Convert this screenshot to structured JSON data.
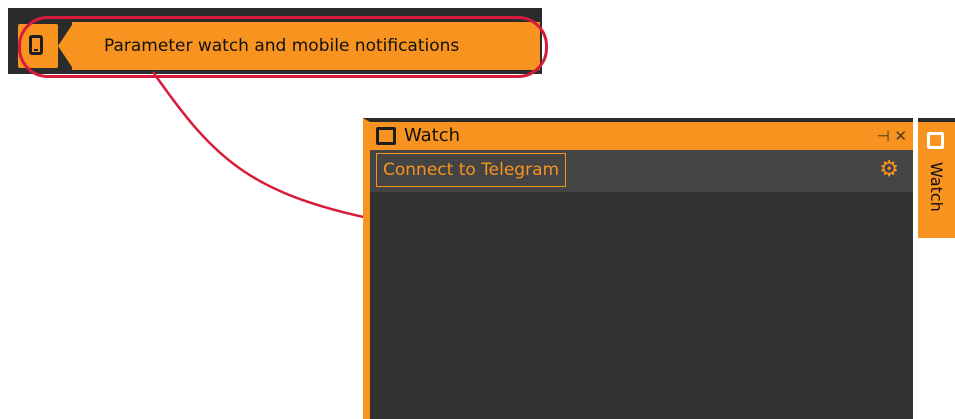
{
  "tooltip": {
    "text": "Parameter watch and mobile notifications"
  },
  "watch_panel": {
    "title": "Watch",
    "controls": "⊣ ✕",
    "connect_button_label": "Connect to Telegram",
    "gear_icon": "⚙"
  },
  "side_tab": {
    "label": "Watch"
  },
  "colors": {
    "accent": "#f7931e",
    "panel_background": "#323232",
    "toolbar_background": "#444444",
    "highlight": "#d81b3a"
  },
  "icons": {
    "toolbar_button": "phone-icon",
    "panel_title": "phone-icon",
    "settings": "gear-icon"
  }
}
